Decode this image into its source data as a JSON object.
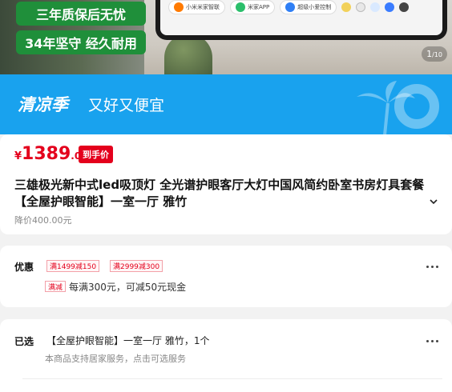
{
  "hero": {
    "badge1": "三年质保后无忧",
    "badge2": "34年坚守 经久耐用",
    "apps": [
      "小米米家智联",
      "米家APP",
      "超级小爱控制"
    ],
    "counter_current": "1",
    "counter_total": "/10"
  },
  "banner": {
    "title": "清凉季",
    "slogan": "又好又便宜",
    "color": "#19a2ee"
  },
  "product": {
    "price_symbol": "¥",
    "price_int": "1389",
    "price_dec": ".00",
    "hand_price_tag": "到手价",
    "title": "三雄极光新中式led吸顶灯 全光谱护眼客厅大灯中国风简约卧室书房灯具套餐 【全屋护眼智能】一室一厅 雅竹",
    "original_price": "降价400.00元",
    "accent": "#e4001c"
  },
  "promo": {
    "label": "优惠",
    "coupons": [
      "满1499减150",
      "满2999减300"
    ],
    "full_tag": "满减",
    "full_text": "每满300元，可减50元现金"
  },
  "selected": {
    "label": "已选",
    "value": "【全屋护眼智能】一室一厅 雅竹，1个",
    "sub": "本商品支持居家服务，点击可选服务"
  }
}
